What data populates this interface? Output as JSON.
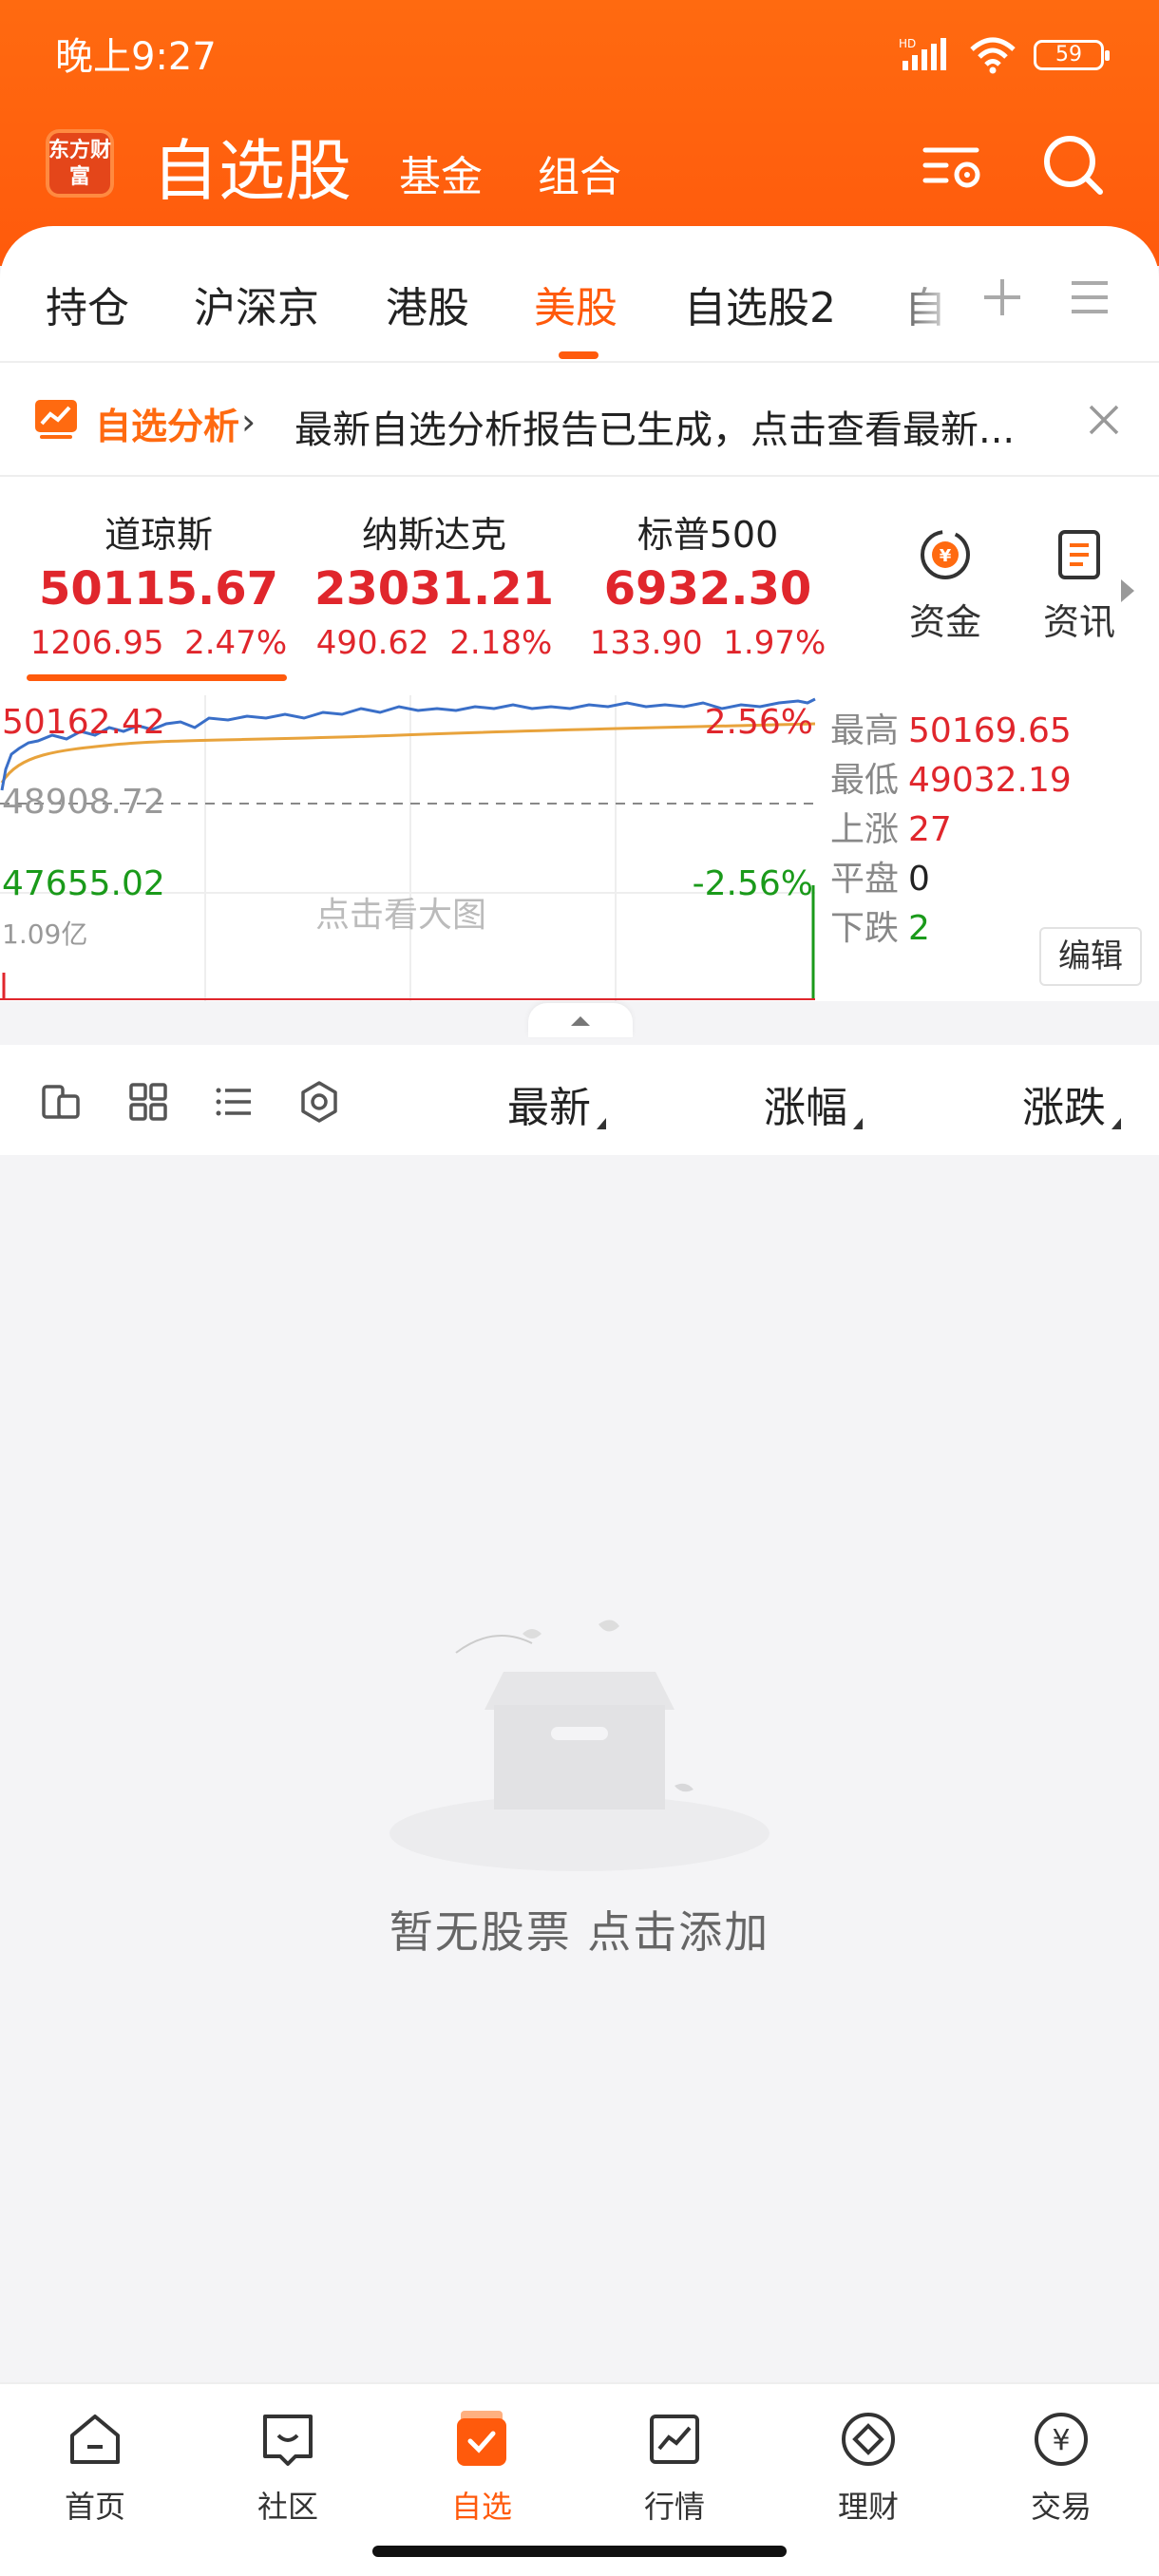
{
  "status_bar": {
    "time": "晚上9:27",
    "battery": "59",
    "signal_label": "HD"
  },
  "header": {
    "logo_text": "东方财富",
    "title": "自选股",
    "nav": [
      "基金",
      "组合"
    ]
  },
  "tabs": {
    "items": [
      "持仓",
      "沪深京",
      "港股",
      "美股",
      "自选股2",
      "自"
    ],
    "active": "美股"
  },
  "banner": {
    "tag": "自选分析",
    "message": "最新自选分析报告已生成，点击查看最新..."
  },
  "indices": [
    {
      "name": "道琼斯",
      "value": "50115.67",
      "change": "1206.95",
      "percent": "2.47%"
    },
    {
      "name": "纳斯达克",
      "value": "23031.21",
      "change": "490.62",
      "percent": "2.18%"
    },
    {
      "name": "标普500",
      "value": "6932.30",
      "change": "133.90",
      "percent": "1.97%"
    }
  ],
  "side_buttons": [
    "资金",
    "资讯"
  ],
  "chart": {
    "top_value": "50162.42",
    "mid_value": "48908.72",
    "bottom_value": "47655.02",
    "top_pct": "2.56%",
    "bottom_pct": "-2.56%",
    "volume": "1.09亿",
    "overlay": "点击看大图"
  },
  "stats": {
    "high_label": "最高",
    "high": "50169.65",
    "low_label": "最低",
    "low": "49032.19",
    "up_label": "上涨",
    "up": "27",
    "flat_label": "平盘",
    "flat": "0",
    "down_label": "下跌",
    "down": "2",
    "edit": "编辑"
  },
  "list_header": {
    "latest": "最新",
    "change_pct": "涨幅",
    "change": "涨跌"
  },
  "empty": {
    "text": "暂无股票  点击添加"
  },
  "bottom_nav": [
    {
      "label": "首页",
      "icon": "home-icon"
    },
    {
      "label": "社区",
      "icon": "community-icon"
    },
    {
      "label": "自选",
      "icon": "watchlist-icon",
      "active": true
    },
    {
      "label": "行情",
      "icon": "market-icon"
    },
    {
      "label": "理财",
      "icon": "wealth-icon"
    },
    {
      "label": "交易",
      "icon": "trade-icon"
    }
  ],
  "colors": {
    "brand": "#ff5a0c",
    "up": "#e0262c",
    "down": "#1a9a1a"
  }
}
